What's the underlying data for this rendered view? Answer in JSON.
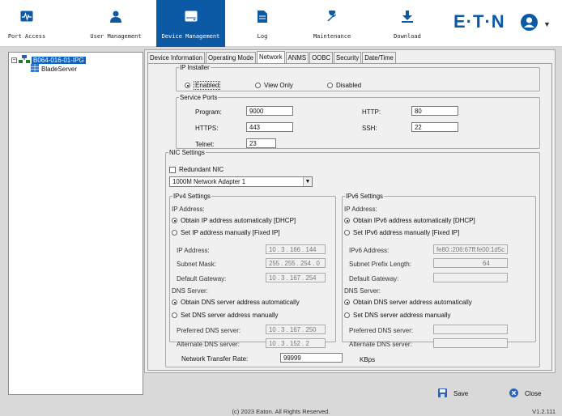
{
  "nav": {
    "items": [
      {
        "label": "Port Access",
        "icon": "port-access-icon"
      },
      {
        "label": "User Management",
        "icon": "user-icon"
      },
      {
        "label": "Device Management",
        "icon": "device-icon"
      },
      {
        "label": "Log",
        "icon": "log-icon"
      },
      {
        "label": "Maintenance",
        "icon": "wrench-icon"
      },
      {
        "label": "Download",
        "icon": "download-icon"
      }
    ],
    "active": "Device Management",
    "logo": "E·T·N",
    "brand_color": "#0c5aa6"
  },
  "tree": {
    "root": "B064-016-01-IPG",
    "child": "BladeServer"
  },
  "tabs": [
    "Device Information",
    "Operating Mode",
    "Network",
    "ANMS",
    "OOBC",
    "Security",
    "Date/Time"
  ],
  "active_tab": "Network",
  "ip_installer": {
    "legend": "IP Installer",
    "options": [
      "Enabled",
      "View Only",
      "Disabled"
    ],
    "selected": "Enabled"
  },
  "service_ports": {
    "legend": "Service Ports",
    "program_label": "Program:",
    "program": "9000",
    "http_label": "HTTP:",
    "http": "80",
    "https_label": "HTTPS:",
    "https": "443",
    "ssh_label": "SSH:",
    "ssh": "22",
    "telnet_label": "Telnet:",
    "telnet": "23"
  },
  "nic": {
    "legend": "NIC Settings",
    "redundant_label": "Redundant NIC",
    "adapter": "1000M Network Adapter 1",
    "ipv4": {
      "legend": "IPv4 Settings",
      "ip_address_header": "IP Address:",
      "dhcp_label": "Obtain IP address automatically [DHCP]",
      "fixed_label": "Set IP address manually [Fixed IP]",
      "ip_label": "IP Address:",
      "ip": "10  . 3    . 166 . 144",
      "mask_label": "Subnet Mask:",
      "mask": "255 . 255 . 254 . 0",
      "gw_label": "Default Gateway:",
      "gw": "10  . 3    . 167 . 254",
      "dns_header": "DNS Server:",
      "dns_auto_label": "Obtain DNS server address automatically",
      "dns_manual_label": "Set DNS server address manually",
      "pref_label": "Preferred DNS server:",
      "pref": "10  . 3    . 167 . 250",
      "alt_label": "Alternate DNS server:",
      "alt": "10  . 3    . 152 . 2"
    },
    "ipv6": {
      "legend": "IPv6 Settings",
      "ip_address_header": "IP Address:",
      "dhcp_label": "Obtain IPv6 address automatically [DHCP]",
      "fixed_label": "Set IPv6 address manually [Fixed IP]",
      "ip_label": "IPv6 Address:",
      "ip": "fe80::206:67ff:fe00:1d5c",
      "prefix_label": "Subnet Prefix Length:",
      "prefix": "64",
      "gw_label": "Default Gateway:",
      "gw": "",
      "dns_header": "DNS Server:",
      "dns_auto_label": "Obtain DNS server address automatically",
      "dns_manual_label": "Set DNS server address manually",
      "pref_label": "Preferred DNS server:",
      "pref": "",
      "alt_label": "Alternate DNS server:",
      "alt": ""
    },
    "rate_label": "Network Transfer Rate:",
    "rate": "99999",
    "rate_unit": "KBps"
  },
  "actions": {
    "save": "Save",
    "close": "Close"
  },
  "footer": {
    "copyright": "(c) 2023 Eaton. All Rights Reserved.",
    "version": "V1.2.111"
  }
}
